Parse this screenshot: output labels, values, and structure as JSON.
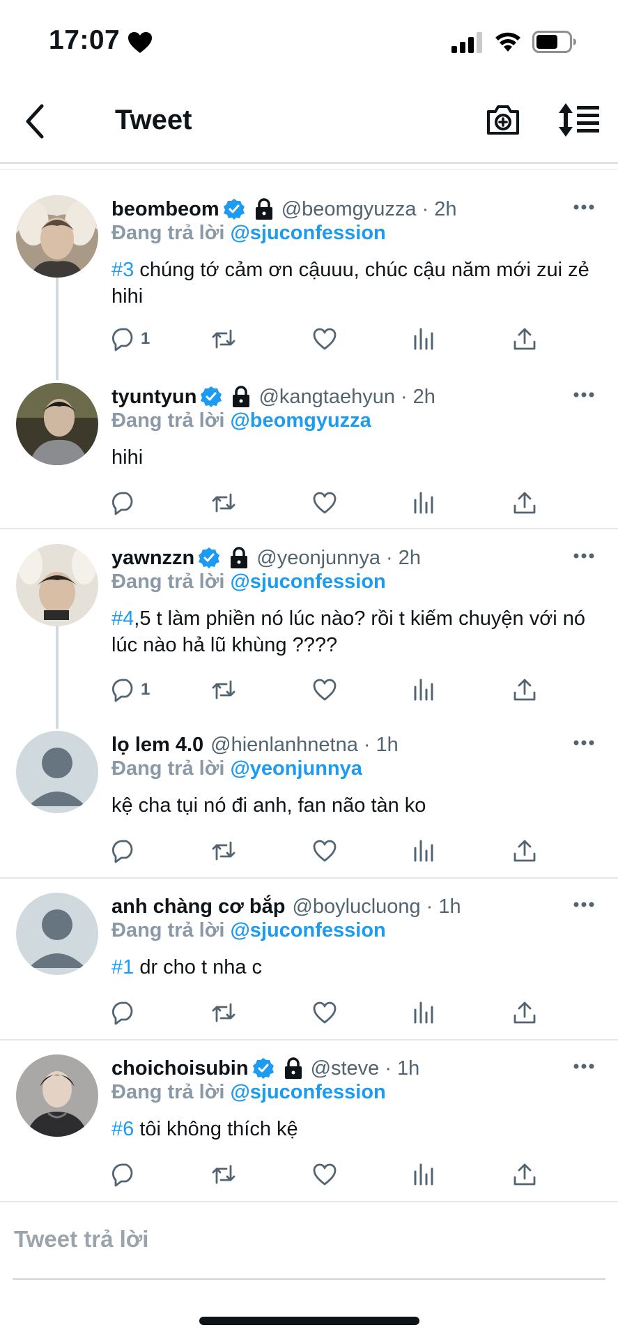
{
  "status_bar": {
    "time": "17:07",
    "icons": [
      "heart-icon",
      "signal-icon",
      "wifi-icon",
      "battery-icon"
    ]
  },
  "header": {
    "title": "Tweet",
    "icons": [
      "back-icon",
      "camera-icon",
      "sort-icon"
    ]
  },
  "colors": {
    "accent": "#1d9bf0",
    "muted": "#536471",
    "reply_prefix": "#8b98a5"
  },
  "reply_prefix": "Đang trả lời",
  "tweets": [
    {
      "name": "beombeom",
      "handle": "@beomgyuzza",
      "dot": "·",
      "time": "2h",
      "replying_to": "@sjuconfession",
      "tag": "#3",
      "text": " chúng tớ cảm ơn cậuuu, chúc cậu năm mới zui zẻ hihi",
      "reply_count": "1",
      "verified": true,
      "protected": true
    },
    {
      "name": "tyuntyun",
      "handle": "@kangtaehyun",
      "dot": "·",
      "time": "2h",
      "replying_to": "@beomgyuzza",
      "tag": "",
      "text": "hihi",
      "reply_count": "",
      "verified": true,
      "protected": true
    },
    {
      "name": "yawnzzn",
      "handle": "@yeonjunnya",
      "dot": "·",
      "time": "2h",
      "replying_to": "@sjuconfession",
      "tag": "#4",
      "text": ",5 t làm phiền nó lúc nào? rồi t kiếm chuyện với nó lúc nào hả lũ khùng ????",
      "reply_count": "1",
      "verified": true,
      "protected": true
    },
    {
      "name": "lọ lem 4.0",
      "handle": "@hienlanhnetna",
      "dot": "·",
      "time": "1h",
      "replying_to": "@yeonjunnya",
      "tag": "",
      "text": "kệ cha tụi nó đi anh, fan não tàn ko",
      "reply_count": "",
      "verified": false,
      "protected": false
    },
    {
      "name": "anh chàng cơ bắp",
      "handle": "@boylucluong",
      "dot": "·",
      "time": "1h",
      "replying_to": "@sjuconfession",
      "tag": "#1",
      "text": " dr cho t nha c",
      "reply_count": "",
      "verified": false,
      "protected": false
    },
    {
      "name": "choichoisubin",
      "handle": "@steve",
      "dot": "·",
      "time": "1h",
      "replying_to": "@sjuconfession",
      "tag": "#6",
      "text": " tôi không thích kệ",
      "reply_count": "",
      "verified": true,
      "protected": true
    }
  ],
  "composer": {
    "placeholder": "Tweet trả lời"
  }
}
